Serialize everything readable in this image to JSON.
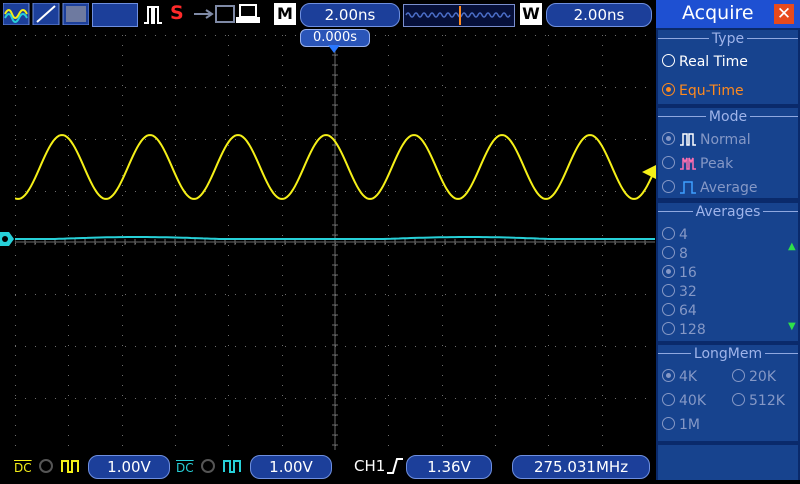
{
  "toolbar": {
    "memory_label": "M",
    "timebase": "2.00ns",
    "window_label": "W",
    "window_timebase": "2.00ns",
    "status_letter": "S",
    "icons": [
      "waveform-icon",
      "slope-icon",
      "display-icon",
      "run-pulse-icon",
      "usb-icon",
      "disk-icon",
      "printer-icon"
    ]
  },
  "screen": {
    "trigger_time": "0.000s",
    "channel1_color": "#f5f018",
    "channel2_color": "#27d0d8",
    "grid_color": "#6b6b6b"
  },
  "bottom": {
    "ch1_coupling": "DC",
    "ch1_scale": "1.00V",
    "ch2_coupling": "DC",
    "ch2_scale": "1.00V",
    "trigger_source": "CH1",
    "trigger_level": "1.36V",
    "frequency": "275.031MHz"
  },
  "panel": {
    "title": "Acquire",
    "type": {
      "heading": "Type",
      "options": [
        {
          "label": "Real Time",
          "selected": false
        },
        {
          "label": "Equ-Time",
          "selected": true
        }
      ]
    },
    "mode": {
      "heading": "Mode",
      "options": [
        {
          "label": "Normal",
          "selected": true
        },
        {
          "label": "Peak",
          "selected": false
        },
        {
          "label": "Average",
          "selected": false
        }
      ]
    },
    "averages": {
      "heading": "Averages",
      "options": [
        "4",
        "8",
        "16",
        "32",
        "64",
        "128"
      ],
      "selected": "16"
    },
    "longmem": {
      "heading": "LongMem",
      "options": [
        "4K",
        "20K",
        "40K",
        "512K",
        "1M"
      ],
      "selected": "4K"
    }
  }
}
